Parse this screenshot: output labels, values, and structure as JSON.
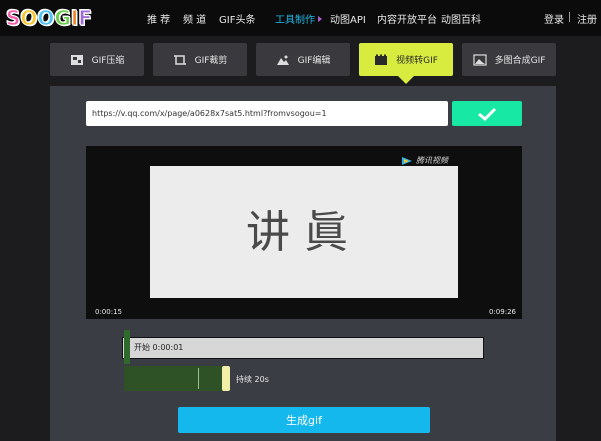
{
  "header": {
    "logo": "SOOGIF",
    "nav": [
      {
        "label": "推 荐"
      },
      {
        "label": "频 道"
      },
      {
        "label": "GIF头条"
      },
      {
        "label": "工具制作"
      },
      {
        "label": "动图API"
      },
      {
        "label": "内容开放平台"
      },
      {
        "label": "动图百科"
      }
    ],
    "login": "登录",
    "register": "注册"
  },
  "tabs": [
    {
      "label": "GIF压缩",
      "icon": "zip-icon"
    },
    {
      "label": "GIF裁剪",
      "icon": "crop-icon"
    },
    {
      "label": "GIF编辑",
      "icon": "image-edit-icon"
    },
    {
      "label": "视频转GIF",
      "icon": "video-icon"
    },
    {
      "label": "多图合成GIF",
      "icon": "images-icon"
    }
  ],
  "url_input": {
    "value": "https://v.qq.com/x/page/a0628x7sat5.html?fromvsogou=1"
  },
  "video": {
    "caption": "讲眞",
    "brand": "腾讯视频",
    "time_start": "0:00:15",
    "time_end": "0:09:26"
  },
  "timeline": {
    "start_label": "开始 0:00:01",
    "duration_label": "持续 20s"
  },
  "generate_button": "生成gif",
  "colors": {
    "accent_green": "#17e8a4",
    "active_tab": "#d8ec40",
    "generate_blue": "#15b8ec",
    "nav_active": "#22b8e6"
  }
}
